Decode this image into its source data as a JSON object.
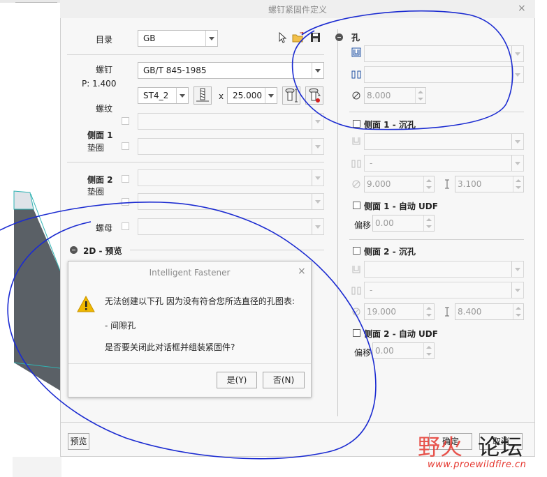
{
  "main_dialog": {
    "title": "螺钉紧固件定义",
    "close_glyph": "×",
    "catalog": {
      "label": "目录",
      "value": "GB"
    },
    "screw": {
      "label": "螺钉",
      "pitch_text": "P: 1.400",
      "standard": "GB/T 845-1985",
      "size": "ST4_2",
      "times": "x",
      "length": "25.000"
    },
    "thread_label": "螺纹",
    "side1_washer": {
      "label_line1": "侧面 1",
      "label_line2": "垫圈"
    },
    "side2_washer": {
      "label_line1": "侧面 2",
      "label_line2": "垫圈"
    },
    "nut_label": "螺母",
    "preview_section_label": "2D - 预览",
    "preview_button": "预览",
    "ok_button": "确定",
    "cancel_button": "取消"
  },
  "hole_panel": {
    "title": "孔",
    "diameter_value": "8.000",
    "side1_counterbore": {
      "label": "侧面 1 - 沉孔",
      "combo2_value": "-",
      "diameter": "9.000",
      "depth": "3.100"
    },
    "side1_auto_udf": {
      "label": "侧面 1 - 自动 UDF",
      "offset_label": "偏移",
      "offset_value": "0.00"
    },
    "side2_counterbore": {
      "label": "侧面 2 - 沉孔",
      "combo2_value": "-",
      "diameter": "19.000",
      "depth": "8.400"
    },
    "side2_auto_udf": {
      "label": "侧面 2 - 自动 UDF",
      "offset_label": "偏移",
      "offset_value": "0.00"
    }
  },
  "popup": {
    "title": "Intelligent Fastener",
    "close_glyph": "×",
    "line1": "无法创建以下孔 因为没有符合您所选直径的孔图表:",
    "line2": "- 间隙孔",
    "line3": "是否要关闭此对话框并组装紧固件?",
    "yes_button": "是(Y)",
    "no_button": "否(N)"
  },
  "watermark": {
    "brand_left": "野火",
    "brand_right": "论坛",
    "url": "www.proewildfire.cn"
  },
  "colors": {
    "annotation_ink": "#1b2bd1",
    "model_gray": "#5a6066",
    "model_edge": "#2fb3b3",
    "warning": "#f0b800",
    "watermark_red": "#e5362e"
  }
}
